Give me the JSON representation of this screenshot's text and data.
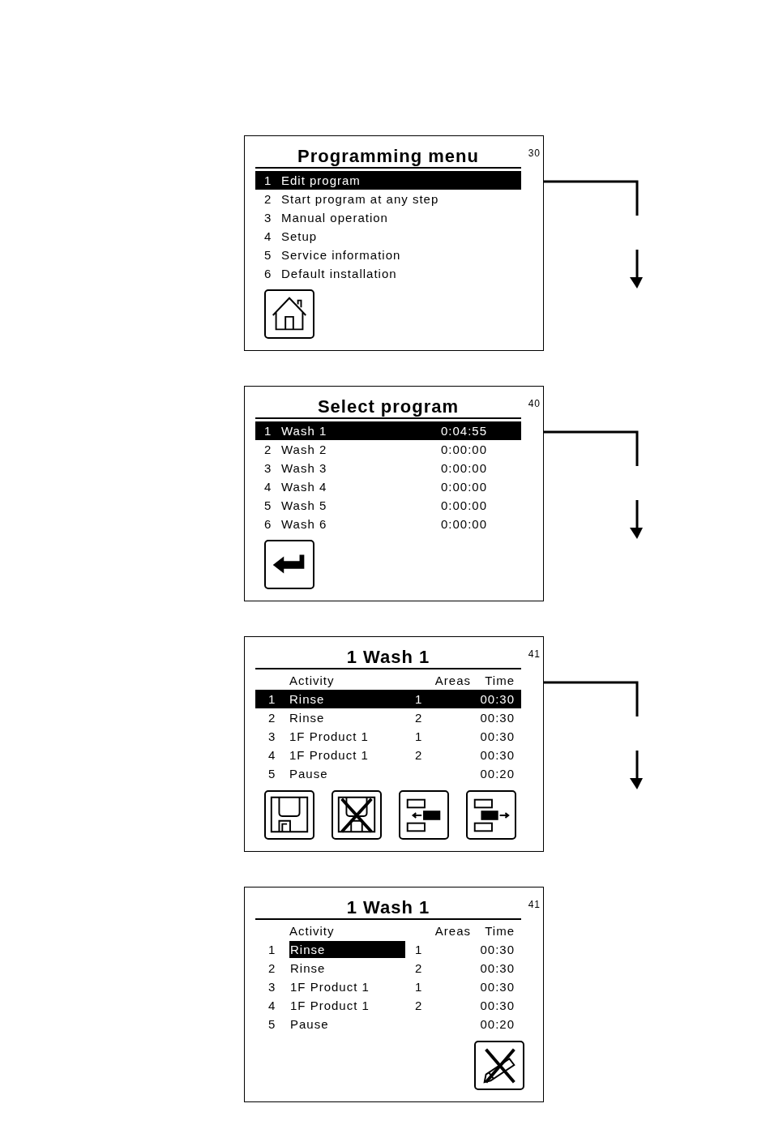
{
  "screens": [
    {
      "kind": "menu",
      "title": "Programming menu",
      "page_number": "30",
      "arrow": true,
      "rows": [
        {
          "cells": [
            "1",
            "Edit program"
          ],
          "selected": true
        },
        {
          "cells": [
            "2",
            "Start program at any step"
          ],
          "selected": false
        },
        {
          "cells": [
            "3",
            "Manual operation"
          ],
          "selected": false
        },
        {
          "cells": [
            "4",
            "Setup"
          ],
          "selected": false
        },
        {
          "cells": [
            "5",
            "Service information"
          ],
          "selected": false
        },
        {
          "cells": [
            "6",
            "Default installation"
          ],
          "selected": false
        }
      ],
      "buttons": [
        {
          "kind": "home"
        }
      ]
    },
    {
      "kind": "program_list",
      "title": "Select program",
      "page_number": "40",
      "arrow": true,
      "rows": [
        {
          "cells": [
            "1",
            "Wash 1",
            "0:04:55"
          ],
          "selected": true
        },
        {
          "cells": [
            "2",
            "Wash 2",
            "0:00:00"
          ],
          "selected": false
        },
        {
          "cells": [
            "3",
            "Wash 3",
            "0:00:00"
          ],
          "selected": false
        },
        {
          "cells": [
            "4",
            "Wash 4",
            "0:00:00"
          ],
          "selected": false
        },
        {
          "cells": [
            "5",
            "Wash 5",
            "0:00:00"
          ],
          "selected": false
        },
        {
          "cells": [
            "6",
            "Wash 6",
            "0:00:00"
          ],
          "selected": false
        }
      ],
      "buttons": [
        {
          "kind": "enter"
        }
      ]
    },
    {
      "kind": "steps",
      "title": "1 Wash 1",
      "page_number": "41",
      "arrow": true,
      "columns": [
        "",
        "Activity",
        "Areas",
        "Time"
      ],
      "rows": [
        {
          "cells": [
            "1",
            "Rinse",
            "1",
            "00:30"
          ],
          "selected": true
        },
        {
          "cells": [
            "2",
            "Rinse",
            "2",
            "00:30"
          ],
          "selected": false
        },
        {
          "cells": [
            "3",
            "1F Product 1",
            "1",
            "00:30"
          ],
          "selected": false
        },
        {
          "cells": [
            "4",
            "1F Product 1",
            "2",
            "00:30"
          ],
          "selected": false
        },
        {
          "cells": [
            "5",
            "Pause",
            "",
            "00:20"
          ],
          "selected": false
        }
      ],
      "buttons": [
        {
          "kind": "save"
        },
        {
          "kind": "discard"
        },
        {
          "kind": "move_left"
        },
        {
          "kind": "move_right"
        }
      ]
    },
    {
      "kind": "step_edit",
      "title": "1 Wash 1",
      "page_number": "41",
      "arrow": false,
      "columns": [
        "",
        "Activity",
        "Areas",
        "Time"
      ],
      "rows": [
        {
          "cells": [
            "1",
            "Rinse",
            "1",
            "00:30"
          ],
          "selected": true
        },
        {
          "cells": [
            "2",
            "Rinse",
            "2",
            "00:30"
          ],
          "selected": false
        },
        {
          "cells": [
            "3",
            "1F Product 1",
            "1",
            "00:30"
          ],
          "selected": false
        },
        {
          "cells": [
            "4",
            "1F Product 1",
            "2",
            "00:30"
          ],
          "selected": false
        },
        {
          "cells": [
            "5",
            "Pause",
            "",
            "00:20"
          ],
          "selected": false
        }
      ],
      "buttons": [
        {
          "kind": "no_edit"
        }
      ]
    }
  ]
}
